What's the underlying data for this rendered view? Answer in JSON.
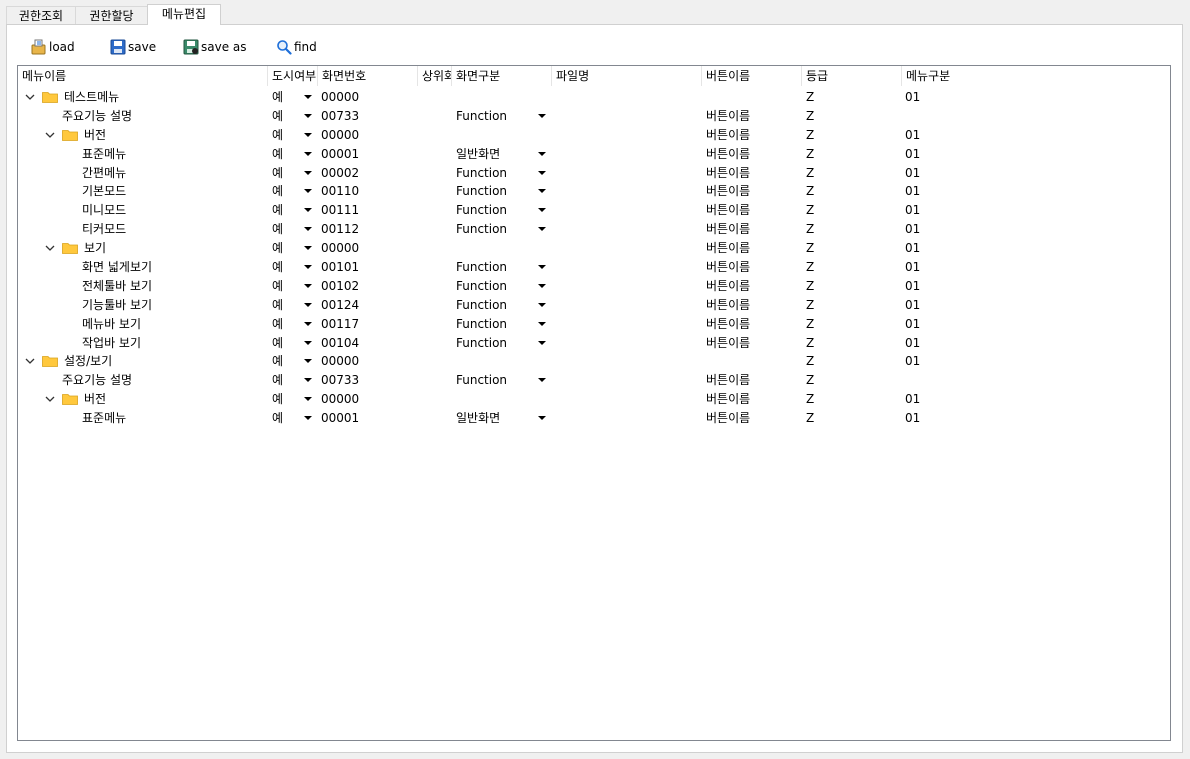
{
  "tabs": [
    {
      "label": "권한조회",
      "active": false
    },
    {
      "label": "권한할당",
      "active": false
    },
    {
      "label": "메뉴편집",
      "active": true
    }
  ],
  "toolbar": {
    "load_label": "load",
    "save_label": "save",
    "save_as_label": "save as",
    "find_label": "find"
  },
  "grid": {
    "columns": [
      "메뉴이름",
      "도시여부",
      "화면번호",
      "상위화면",
      "화면구분",
      "파일명",
      "버튼이름",
      "등급",
      "메뉴구분"
    ],
    "rows": [
      {
        "level": 0,
        "expandable": true,
        "folder": true,
        "name": "테스트메뉴",
        "display": "예",
        "screen_no": "00000",
        "parent": "",
        "screen_type": "",
        "file": "",
        "button": "",
        "grade": "Z",
        "menu_type": " 01"
      },
      {
        "level": 1,
        "expandable": false,
        "folder": false,
        "name": "주요기능 설명",
        "display": "예",
        "screen_no": "00733",
        "parent": "",
        "screen_type": "Function",
        "file": "",
        "button": "버튼이름",
        "grade": "Z",
        "menu_type": ""
      },
      {
        "level": 1,
        "expandable": true,
        "folder": true,
        "name": "버전",
        "display": "예",
        "screen_no": "00000",
        "parent": "",
        "screen_type": "",
        "file": "",
        "button": "버튼이름",
        "grade": "Z",
        "menu_type": "01"
      },
      {
        "level": 2,
        "expandable": false,
        "folder": false,
        "name": "표준메뉴",
        "display": "예",
        "screen_no": "00001",
        "parent": "",
        "screen_type": "일반화면",
        "file": "",
        "button": "버튼이름",
        "grade": "Z",
        "menu_type": "01"
      },
      {
        "level": 2,
        "expandable": false,
        "folder": false,
        "name": "간편메뉴",
        "display": "예",
        "screen_no": "00002",
        "parent": "",
        "screen_type": "Function",
        "file": "",
        "button": "버튼이름",
        "grade": "Z",
        "menu_type": "01"
      },
      {
        "level": 2,
        "expandable": false,
        "folder": false,
        "name": "기본모드",
        "display": "예",
        "screen_no": "00110",
        "parent": "",
        "screen_type": "Function",
        "file": "",
        "button": "버튼이름",
        "grade": "Z",
        "menu_type": "01"
      },
      {
        "level": 2,
        "expandable": false,
        "folder": false,
        "name": "미니모드",
        "display": "예",
        "screen_no": "00111",
        "parent": "",
        "screen_type": "Function",
        "file": "",
        "button": "버튼이름",
        "grade": "Z",
        "menu_type": "01"
      },
      {
        "level": 2,
        "expandable": false,
        "folder": false,
        "name": "티커모드",
        "display": "예",
        "screen_no": "00112",
        "parent": "",
        "screen_type": "Function",
        "file": "",
        "button": "버튼이름",
        "grade": "Z",
        "menu_type": "01"
      },
      {
        "level": 1,
        "expandable": true,
        "folder": true,
        "name": "보기",
        "display": "예",
        "screen_no": "00000",
        "parent": "",
        "screen_type": "",
        "file": "",
        "button": "버튼이름",
        "grade": "Z",
        "menu_type": "01"
      },
      {
        "level": 2,
        "expandable": false,
        "folder": false,
        "name": "화면 넓게보기",
        "display": "예",
        "screen_no": "00101",
        "parent": "",
        "screen_type": "Function",
        "file": "",
        "button": "버튼이름",
        "grade": "Z",
        "menu_type": "01"
      },
      {
        "level": 2,
        "expandable": false,
        "folder": false,
        "name": "전체툴바 보기",
        "display": "예",
        "screen_no": "00102",
        "parent": "",
        "screen_type": "Function",
        "file": "",
        "button": "버튼이름",
        "grade": "Z",
        "menu_type": "01"
      },
      {
        "level": 2,
        "expandable": false,
        "folder": false,
        "name": "기능툴바 보기",
        "display": "예",
        "screen_no": "00124",
        "parent": "",
        "screen_type": "Function",
        "file": "",
        "button": "버튼이름",
        "grade": "Z",
        "menu_type": "01"
      },
      {
        "level": 2,
        "expandable": false,
        "folder": false,
        "name": "메뉴바 보기",
        "display": "예",
        "screen_no": "00117",
        "parent": "",
        "screen_type": "Function",
        "file": "",
        "button": "버튼이름",
        "grade": "Z",
        "menu_type": "01"
      },
      {
        "level": 2,
        "expandable": false,
        "folder": false,
        "name": "작업바 보기",
        "display": "예",
        "screen_no": "00104",
        "parent": "",
        "screen_type": "Function",
        "file": "",
        "button": "버튼이름",
        "grade": "Z",
        "menu_type": "01"
      },
      {
        "level": 0,
        "expandable": true,
        "folder": true,
        "name": "설정/보기",
        "display": "예",
        "screen_no": "00000",
        "parent": "",
        "screen_type": "",
        "file": "",
        "button": "",
        "grade": "Z",
        "menu_type": "01"
      },
      {
        "level": 1,
        "expandable": false,
        "folder": false,
        "name": "주요기능 설명",
        "display": "예",
        "screen_no": "00733",
        "parent": "",
        "screen_type": "Function",
        "file": "",
        "button": "버튼이름",
        "grade": "Z",
        "menu_type": ""
      },
      {
        "level": 1,
        "expandable": true,
        "folder": true,
        "name": "버전",
        "display": "예",
        "screen_no": "00000",
        "parent": "",
        "screen_type": "",
        "file": "",
        "button": "버튼이름",
        "grade": "Z",
        "menu_type": "01"
      },
      {
        "level": 2,
        "expandable": false,
        "folder": false,
        "name": "표준메뉴",
        "display": "예",
        "screen_no": "00001",
        "parent": "",
        "screen_type": "일반화면",
        "file": "",
        "button": "버튼이름",
        "grade": "Z",
        "menu_type": "01"
      }
    ]
  },
  "colors": {
    "folder": "#ffc83d",
    "grid_border": "#828790",
    "find_icon": "#1e6fd9"
  }
}
